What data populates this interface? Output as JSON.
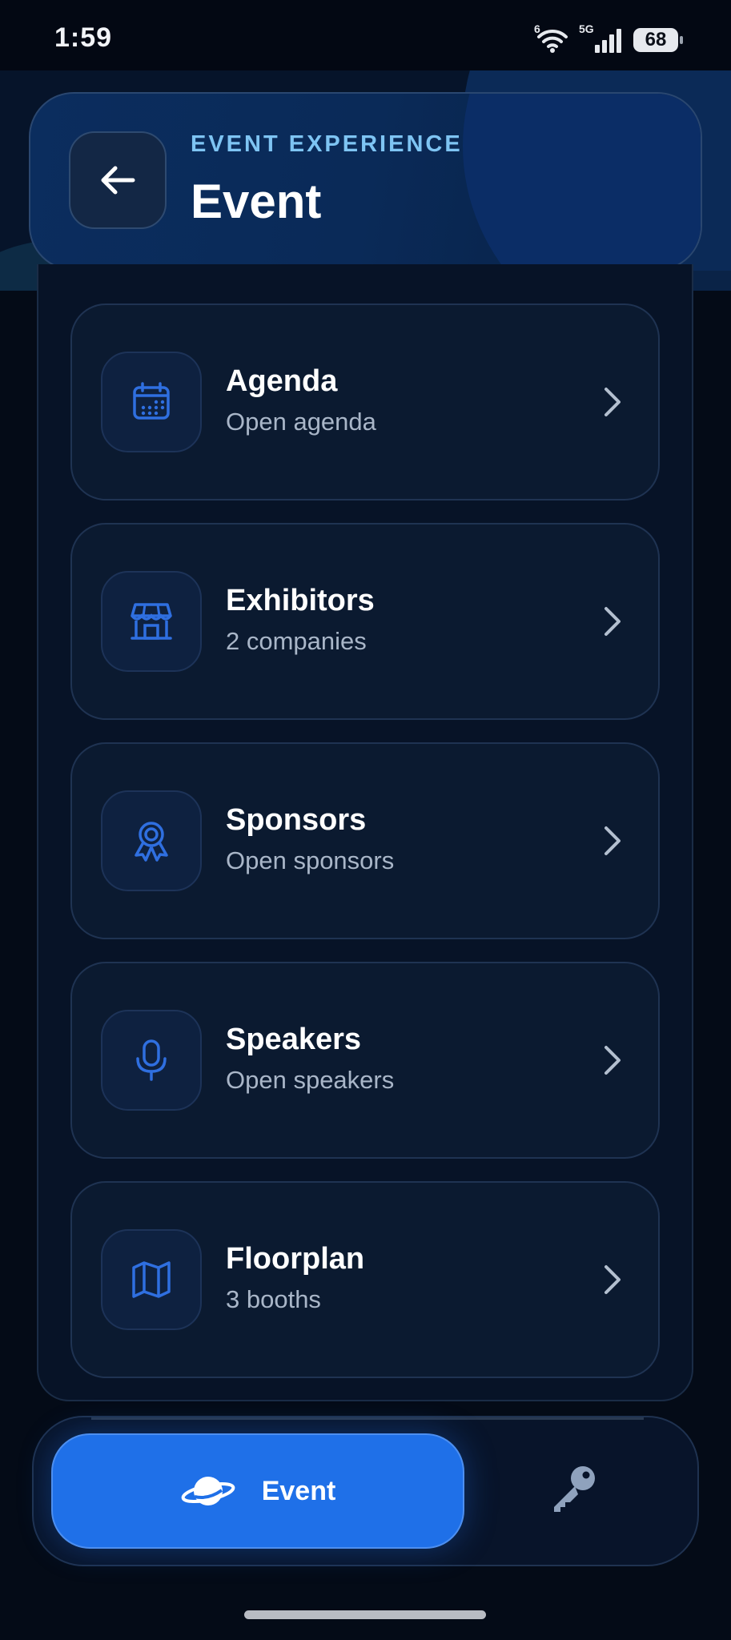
{
  "status_bar": {
    "time": "1:59",
    "wifi_label": "6",
    "signal_label": "5G",
    "battery": "68"
  },
  "header": {
    "eyebrow": "EVENT EXPERIENCE",
    "title": "Event"
  },
  "menu": [
    {
      "title": "Agenda",
      "subtitle": "Open agenda",
      "icon": "calendar-icon"
    },
    {
      "title": "Exhibitors",
      "subtitle": "2 companies",
      "icon": "storefront-icon"
    },
    {
      "title": "Sponsors",
      "subtitle": "Open sponsors",
      "icon": "award-ribbon-icon"
    },
    {
      "title": "Speakers",
      "subtitle": "Open speakers",
      "icon": "microphone-icon"
    },
    {
      "title": "Floorplan",
      "subtitle": "3 booths",
      "icon": "map-icon"
    }
  ],
  "bottom_nav": {
    "event_label": "Event",
    "event_icon": "planet-icon",
    "second_icon": "key-icon"
  },
  "colors": {
    "accent": "#1f70e8",
    "icon_blue": "#2f6fe0",
    "background": "#040b17",
    "eyebrow": "#7ec4f3"
  }
}
